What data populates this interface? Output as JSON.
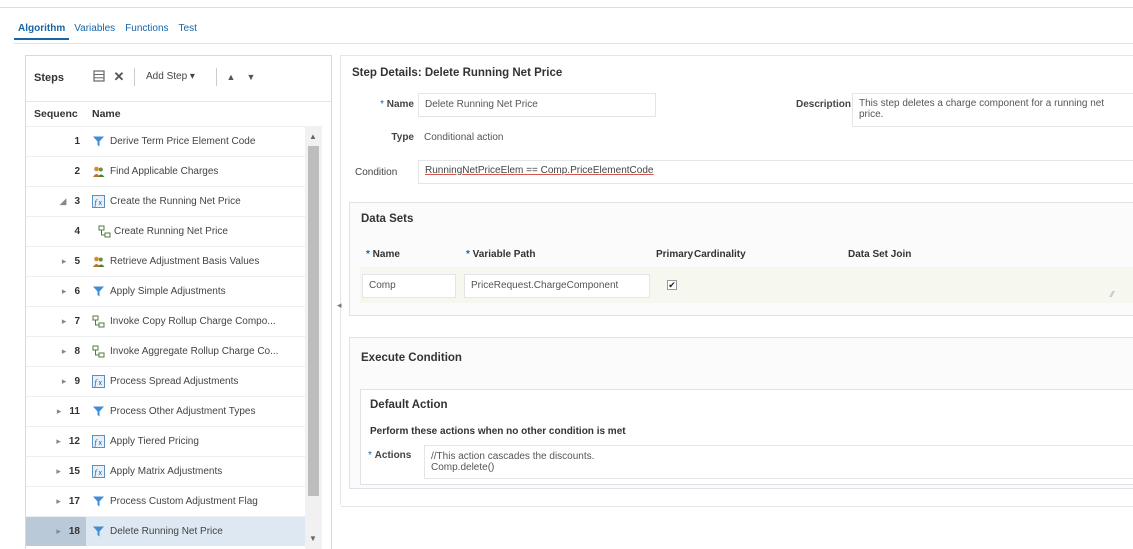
{
  "tabs": [
    {
      "label": "Algorithm",
      "active": true
    },
    {
      "label": "Variables"
    },
    {
      "label": "Functions"
    },
    {
      "label": "Test"
    }
  ],
  "steps": {
    "title": "Steps",
    "add_step_label": "Add Step ▾",
    "columns": {
      "sequence": "Sequenc",
      "name": "Name"
    },
    "rows": [
      {
        "seq": "1",
        "toggle": "",
        "name": "Derive Term Price Element Code",
        "icon": "filter-icon"
      },
      {
        "seq": "2",
        "toggle": "",
        "name": "Find Applicable Charges",
        "icon": "people-icon"
      },
      {
        "seq": "3",
        "toggle": "◢",
        "name": "Create the Running Net Price",
        "icon": "function-icon"
      },
      {
        "seq": "4",
        "toggle": "",
        "name": "Create Running Net Price",
        "icon": "branch-icon",
        "indent": true
      },
      {
        "seq": "5",
        "toggle": "▸",
        "name": "Retrieve Adjustment Basis Values",
        "icon": "people-icon"
      },
      {
        "seq": "6",
        "toggle": "▸",
        "name": "Apply Simple Adjustments",
        "icon": "filter-icon"
      },
      {
        "seq": "7",
        "toggle": "▸",
        "name": "Invoke Copy Rollup Charge Compo...",
        "icon": "branch-icon"
      },
      {
        "seq": "8",
        "toggle": "▸",
        "name": "Invoke Aggregate Rollup Charge Co...",
        "icon": "branch-icon"
      },
      {
        "seq": "9",
        "toggle": "▸",
        "name": "Process Spread Adjustments",
        "icon": "function-icon"
      },
      {
        "seq": "11",
        "toggle": "▸",
        "name": "Process Other Adjustment Types",
        "icon": "filter-icon"
      },
      {
        "seq": "12",
        "toggle": "▸",
        "name": "Apply Tiered Pricing",
        "icon": "function-icon"
      },
      {
        "seq": "15",
        "toggle": "▸",
        "name": "Apply Matrix Adjustments",
        "icon": "function-icon"
      },
      {
        "seq": "17",
        "toggle": "▸",
        "name": "Process Custom Adjustment Flag",
        "icon": "filter-icon"
      },
      {
        "seq": "18",
        "toggle": "▸",
        "name": "Delete Running Net Price",
        "icon": "filter-icon",
        "selected": true
      }
    ]
  },
  "details": {
    "title": "Step Details: Delete Running Net Price",
    "name_label": "Name",
    "name_value": "Delete Running Net Price",
    "type_label": "Type",
    "type_value": "Conditional action",
    "description_label": "Description",
    "description_value": "This step deletes a charge component for a running net price.",
    "condition_label": "Condition",
    "condition_value": "RunningNetPriceElem == Comp.PriceElementCode"
  },
  "data_sets": {
    "title": "Data Sets",
    "columns": {
      "name": "Name",
      "variable_path": "Variable Path",
      "primary": "Primary",
      "cardinality": "Cardinality",
      "join": "Data Set Join"
    },
    "row": {
      "name": "Comp",
      "variable_path": "PriceRequest.ChargeComponent",
      "primary": "✔"
    }
  },
  "execute": {
    "title": "Execute Condition",
    "default_title": "Default Action",
    "default_desc": "Perform these actions when no other condition is met",
    "actions_label": "Actions",
    "actions_line1": "//This action cascades the discounts.",
    "actions_line2": "Comp.delete()"
  },
  "colors": {
    "accent": "#1565a8",
    "selected_row": "#dde8f3"
  }
}
